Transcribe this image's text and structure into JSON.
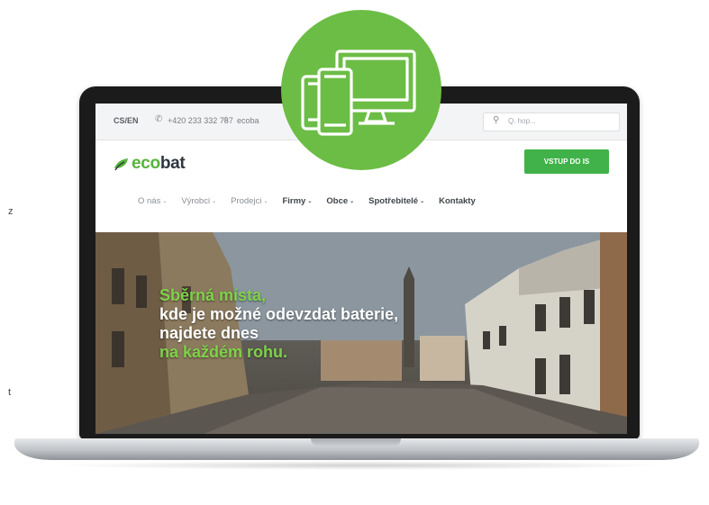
{
  "edge_text": {
    "left_top": "z",
    "left_bottom": "t"
  },
  "site": {
    "topbar": {
      "lang": "CS/EN",
      "phone": "+420 233 332 787",
      "email": "ecoba",
      "search_placeholder": "Q. hop..."
    },
    "logo": {
      "text_eco": "eco",
      "text_bat": "bat"
    },
    "cta_label": "VSTUP DO IS",
    "nav": [
      {
        "label": "O nás",
        "caret": "⌄"
      },
      {
        "label": "Výrobci",
        "caret": "⌄"
      },
      {
        "label": "Prodejci",
        "caret": "⌄"
      },
      {
        "label": "Firmy",
        "caret": "⌄"
      },
      {
        "label": "Obce",
        "caret": "⌄"
      },
      {
        "label": "Spotřebitelé",
        "caret": "⌄"
      },
      {
        "label": "Kontakty",
        "caret": ""
      }
    ],
    "hero": {
      "line1": "Sběrná místa,",
      "line2": "kde je možné odevzdat baterie,",
      "line3": "najdete dnes",
      "line4": "na každém rohu."
    }
  },
  "colors": {
    "accent_green": "#6cbd45",
    "button_green": "#41b24a",
    "highlight_green": "#7fd24a"
  },
  "icons": [
    "phone-icon",
    "mail-icon",
    "search-icon",
    "leaf-icon",
    "devices-icon"
  ]
}
